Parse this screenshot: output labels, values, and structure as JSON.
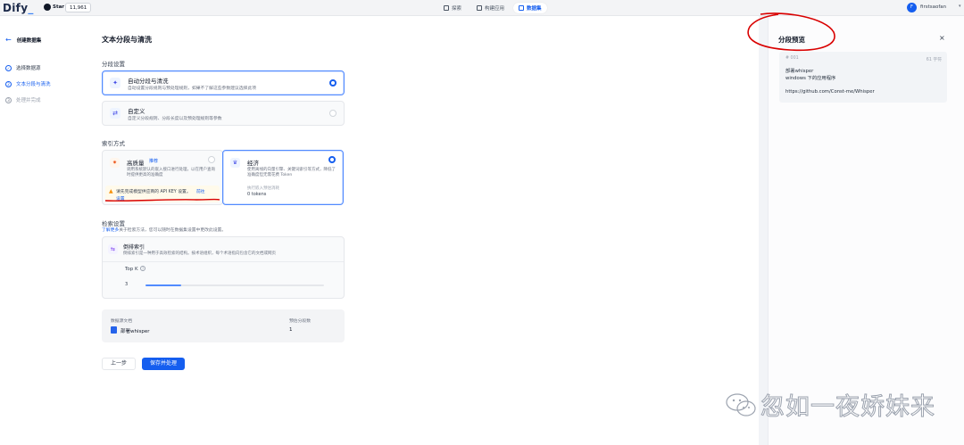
{
  "topbar": {
    "logo": "Dify",
    "star_label": "Star",
    "star_count": "11,961",
    "nav": [
      {
        "label": "探索",
        "icon": "grid-icon"
      },
      {
        "label": "构建应用",
        "icon": "cube-icon"
      },
      {
        "label": "数据集",
        "icon": "database-icon"
      }
    ],
    "active_nav": "数据集",
    "avatar_letter": "F",
    "username": "firstsaofan"
  },
  "sidebar": {
    "back_title": "创建数据集",
    "steps": [
      {
        "label": "选择数据源",
        "state": "done"
      },
      {
        "label": "文本分段与清洗",
        "state": "current",
        "number": "2"
      },
      {
        "label": "处理并完成",
        "state": "todo",
        "number": "3"
      }
    ]
  },
  "main": {
    "title": "文本分段与清洗",
    "segment_label": "分段设置",
    "segment_options": [
      {
        "title": "自动分段与清洗",
        "desc": "自动设置分段规则与预处理规则，如果不了解这些参数建议选择此项",
        "selected": true
      },
      {
        "title": "自定义",
        "desc": "自定义分段规则、分段长度以及预处理规则等参数",
        "selected": false
      }
    ],
    "index_label": "索引方式",
    "index_options": [
      {
        "title": "高质量",
        "badge": "推荐",
        "desc": "调用系统默认的嵌入接口进行处理，以在用户查询时提供更高的准确度",
        "selected": false
      },
      {
        "title": "经济",
        "desc": "使用离线的向量引擎、关键词索引等方式，降低了准确度但无需花费 Token",
        "estimate": "执行嵌入预估消耗",
        "tokens": "0 tokens",
        "selected": true
      }
    ],
    "warning": {
      "text": "请先完成模型供应商的 API KEY 设置。",
      "link1": "前往",
      "link2": "设置"
    },
    "retrieval": {
      "title": "检索设置",
      "desc_link": "了解更多",
      "desc": "关于检索方法，您可以随时在数据集设置中更改此设置。",
      "method_name": "倒排索引",
      "method_desc": "倒排索引是一种用于高效检索的结构。按术语组织，每个术语指向包含它的文档或网页",
      "topk_label": "Top K",
      "topk_value": "3",
      "topk_fraction": 0.2
    },
    "summary": {
      "doc_label": "数据源文档",
      "doc_name": "部署whisper",
      "seg_label": "预估分段数",
      "seg_value": "1"
    },
    "prev_button": "上一步",
    "save_button": "保存并处理"
  },
  "preview": {
    "title": "分段预览",
    "close": "×",
    "chunk": {
      "id": "# 001",
      "chars": "61 字符",
      "lines": [
        "部署whisper",
        "windows 下的应用程序",
        "",
        "https://github.com/Const-me/Whisper"
      ]
    }
  },
  "watermark": {
    "text": "忽如一夜娇妹来"
  },
  "colors": {
    "accent": "#155eef",
    "annotation_red": "#d90000",
    "warning": "#f79009"
  }
}
